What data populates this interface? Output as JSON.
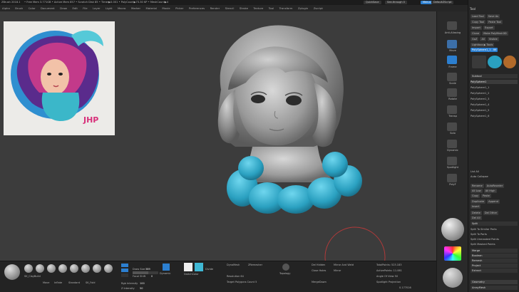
{
  "titlebar": {
    "items": [
      "ZBrush 2018.1",
      "• Free Mem 3.771GB • Active Mem 857 • Scratch Disk 85 • Timer▶0.001 • PolyCount▶73.30 KP • MeshCount▶4"
    ],
    "quicksave": "QuickSave",
    "see_through": "See-through 0",
    "menus_btn": "Menus",
    "default_script": "DefaultZScript"
  },
  "menubar": [
    "Alpha",
    "Brush",
    "Color",
    "Document",
    "Draw",
    "Edit",
    "File",
    "Layer",
    "Light",
    "Macro",
    "Marker",
    "Material",
    "Movie",
    "Picker",
    "Preferences",
    "Render",
    "Stencil",
    "Stroke",
    "Texture",
    "Tool",
    "Transform",
    "Zplugin",
    "Zscript"
  ],
  "reference": {
    "logo": "JHP"
  },
  "right_dock": [
    {
      "label": "Anti-Aliasing"
    },
    {
      "label": "Move"
    },
    {
      "label": "Frame"
    },
    {
      "label": "Scale"
    },
    {
      "label": "Rotate"
    },
    {
      "label": "Transp"
    },
    {
      "label": "Solo"
    },
    {
      "label": "Dynamic"
    },
    {
      "label": "Spotlight"
    },
    {
      "label": "PolyF"
    }
  ],
  "tool_panel": {
    "title": "Tool",
    "rows": [
      [
        "Load Tool",
        "Save As"
      ],
      [
        "Copy Tool",
        "Paste Tool"
      ],
      [
        "Import",
        "Export"
      ],
      [
        "Clone",
        "Make PolyMesh3D"
      ],
      [
        "GoZ",
        "All",
        "Visible"
      ],
      [
        "Lightbox ▶ Tools"
      ],
      [
        "PolySphere1_1 . 86"
      ]
    ],
    "subtools_title": "Subtool",
    "subtools": [
      "PolySphere1",
      "PolySphere1_1",
      "PolySphere1_2",
      "PolySphere1_3",
      "PolySphere1_4",
      "PolySphere1_5",
      "PolySphere1_6"
    ],
    "list": [
      "List All",
      "Auto Collapse"
    ],
    "ops": [
      [
        "Rename",
        "AutoReorder"
      ],
      [
        "All Low",
        "All High"
      ],
      [
        "Copy",
        "Paste"
      ],
      [
        "Duplicate",
        "Append"
      ],
      [
        "",
        "Insert"
      ],
      [
        "Delete",
        "Del Other"
      ],
      [
        "",
        "Del All"
      ]
    ],
    "sections": [
      "Split",
      "Split To Similar Parts",
      "Split To Parts",
      "Split Unmasked Points",
      "Split Masked Points",
      "Merge",
      "Boolean",
      "Remesh",
      "Project",
      "Extract"
    ],
    "footer": [
      "Geometry",
      "ArrayMesh"
    ]
  },
  "bottom": {
    "brushes": [
      "SK_ClayBuild",
      "Move",
      "Inflate",
      "Standard",
      "SK_Fold",
      "hPolish",
      "DamSt",
      "Pinch",
      "Snakehook",
      "SK_Slash3"
    ],
    "draw_size_label": "Draw Size",
    "draw_size_value": "389",
    "dynamic_label": "Dynamic",
    "focal_label": "Focal Shift",
    "focal_value": "0",
    "rgb_intensity_label": "Rgb Intensity",
    "rgb_intensity_value": "100",
    "z_intensity_label": "Z Intensity",
    "z_intensity_value": "50",
    "switch_color": "SwitchColor",
    "divide": "Divide",
    "dynamesh": "DynaMesh",
    "zremesher": "ZRemesher",
    "resolution": "Resolution 64",
    "target_polygons": "Target Polygons Count 5",
    "topology": "Topology",
    "sel_hidden": "Del Hidden",
    "close_holes": "Close Holes",
    "merge_down": "MergeDown",
    "mirror": "Mirror",
    "mirror_weld": "Mirror And Weld",
    "total_points": "TotalPoints: 523.183",
    "active_points": "ActivePoints: 11.061",
    "angle": "Angle Of View 50",
    "spotlight": "Spotlight Projection",
    "uv_val": "0.177016"
  },
  "colors": {
    "accent": "#2c7fd0",
    "teal": "#3fb8d4",
    "sculpt_gray": "#a8a8a8"
  }
}
